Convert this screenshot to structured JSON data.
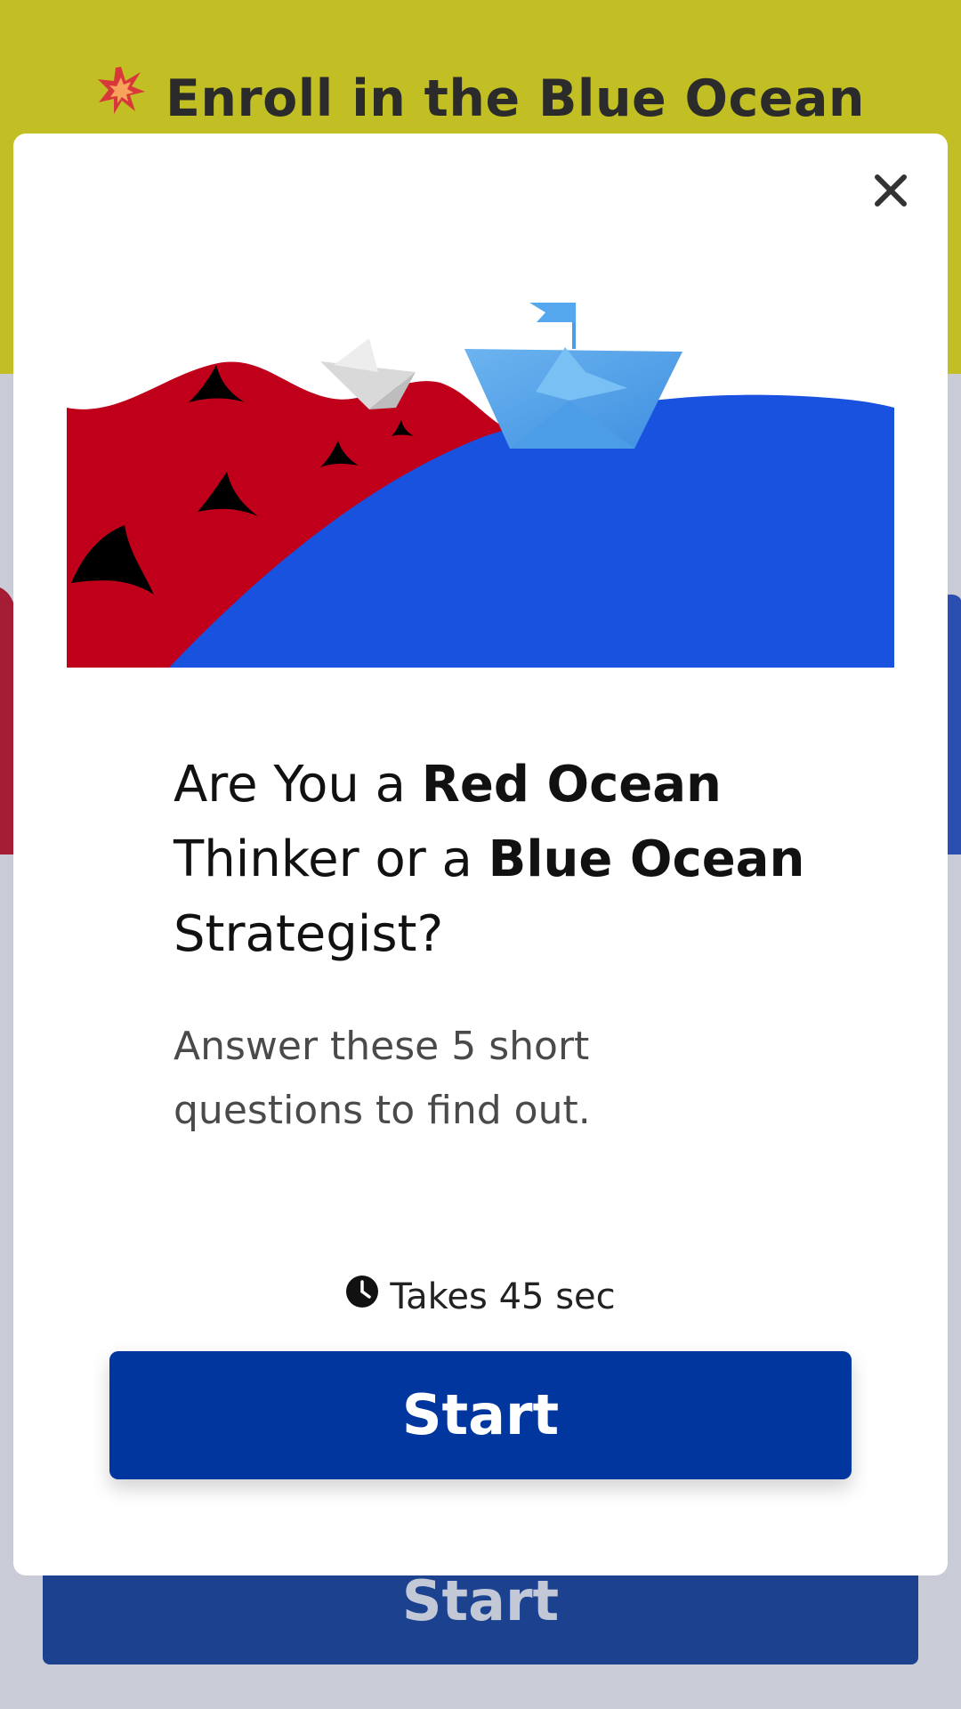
{
  "background": {
    "banner_title": "Enroll in the Blue Ocean",
    "start_label": "Start",
    "colors": {
      "banner": "#c1bf24",
      "button": "#1b418f"
    }
  },
  "modal": {
    "close_icon": "close-icon",
    "headline": {
      "part1": "Are You a ",
      "bold1": "Red Ocean",
      "part2": " Thinker or a ",
      "bold2": "Blue Ocean",
      "part3": " Strategist?"
    },
    "subtext": "Answer these 5 short questions to find out.",
    "duration": "Takes 45 sec",
    "duration_icon": "clock-icon",
    "start_label": "Start",
    "illustration": "red-ocean-blue-ocean-illustration",
    "colors": {
      "red_ocean": "#c0001a",
      "blue_ocean": "#1a52e0",
      "button": "#00369e"
    }
  }
}
